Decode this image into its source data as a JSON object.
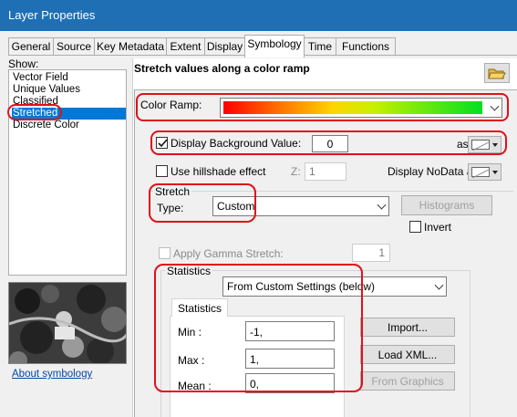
{
  "window": {
    "title": "Layer Properties"
  },
  "tabs": [
    {
      "label": "General"
    },
    {
      "label": "Source"
    },
    {
      "label": "Key Metadata"
    },
    {
      "label": "Extent"
    },
    {
      "label": "Display"
    },
    {
      "label": "Symbology"
    },
    {
      "label": "Time"
    },
    {
      "label": "Functions"
    }
  ],
  "active_tab": "Symbology",
  "sidebar": {
    "show_label": "Show:",
    "items": [
      {
        "label": "Vector Field"
      },
      {
        "label": "Unique Values"
      },
      {
        "label": "Classified"
      },
      {
        "label": "Stretched"
      },
      {
        "label": "Discrete Color"
      }
    ],
    "selected": "Stretched",
    "about_link": "About symbology"
  },
  "main": {
    "heading": "Stretch values along a color ramp",
    "color_ramp_label": "Color Ramp:",
    "display_background": {
      "label": "Display Background Value:",
      "checked": true,
      "value": "0",
      "as_label": "as"
    },
    "hillshade": {
      "label": "Use hillshade effect",
      "checked": false,
      "z_label": "Z:",
      "z_value": "1"
    },
    "nodata_label": "Display NoData as",
    "stretch": {
      "group_label": "Stretch",
      "type_label": "Type:",
      "type_value": "Custom",
      "histograms_button": "Histograms",
      "invert_label": "Invert",
      "gamma_label": "Apply Gamma Stretch:",
      "gamma_value": "1"
    },
    "statistics": {
      "group_label": "Statistics",
      "source_value": "From Custom Settings (below)",
      "inner_tab": "Statistics",
      "min_label": "Min :",
      "min_value": "-1,",
      "max_label": "Max :",
      "max_value": "1,",
      "mean_label": "Mean :",
      "mean_value": "0,",
      "import_button": "Import...",
      "load_xml_button": "Load XML...",
      "from_graphics_button": "From Graphics"
    }
  },
  "colors": {
    "accent": "#0078d7",
    "titlebar": "#1f6fb5",
    "highlight": "#e0101a"
  }
}
